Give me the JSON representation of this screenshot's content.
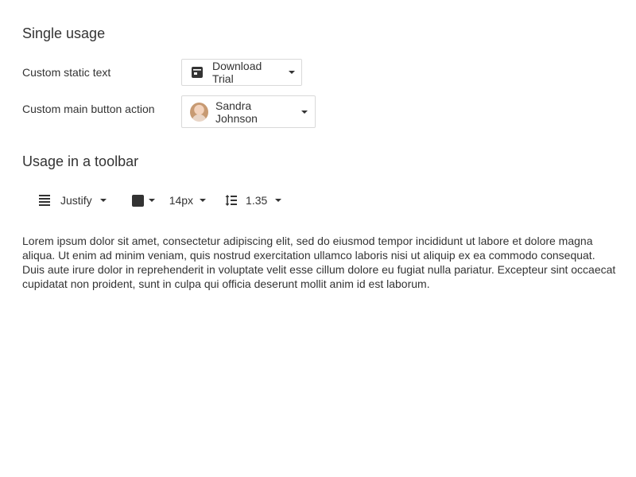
{
  "sections": {
    "single_usage_title": "Single usage",
    "toolbar_usage_title": "Usage in a toolbar"
  },
  "rows": {
    "static_text_label": "Custom static text",
    "main_action_label": "Custom main button action"
  },
  "download_button": {
    "label": "Download Trial",
    "icon": "download-app-icon"
  },
  "user_button": {
    "label": "Sandra Johnson",
    "icon": "avatar"
  },
  "toolbar": {
    "align": {
      "label": "Justify",
      "icon": "text-justify-icon"
    },
    "color": {
      "value": "#333333",
      "icon": "color-swatch"
    },
    "font_size": {
      "label": "14px"
    },
    "line_height": {
      "label": "1.35",
      "icon": "line-height-icon"
    }
  },
  "paragraph": "Lorem ipsum dolor sit amet, consectetur adipiscing elit, sed do eiusmod tempor incididunt ut labore et dolore magna aliqua. Ut enim ad minim veniam, quis nostrud exercitation ullamco laboris nisi ut aliquip ex ea commodo consequat. Duis aute irure dolor in reprehenderit in voluptate velit esse cillum dolore eu fugiat nulla pariatur. Excepteur sint occaecat cupidatat non proident, sunt in culpa qui officia deserunt mollit anim id est laborum."
}
